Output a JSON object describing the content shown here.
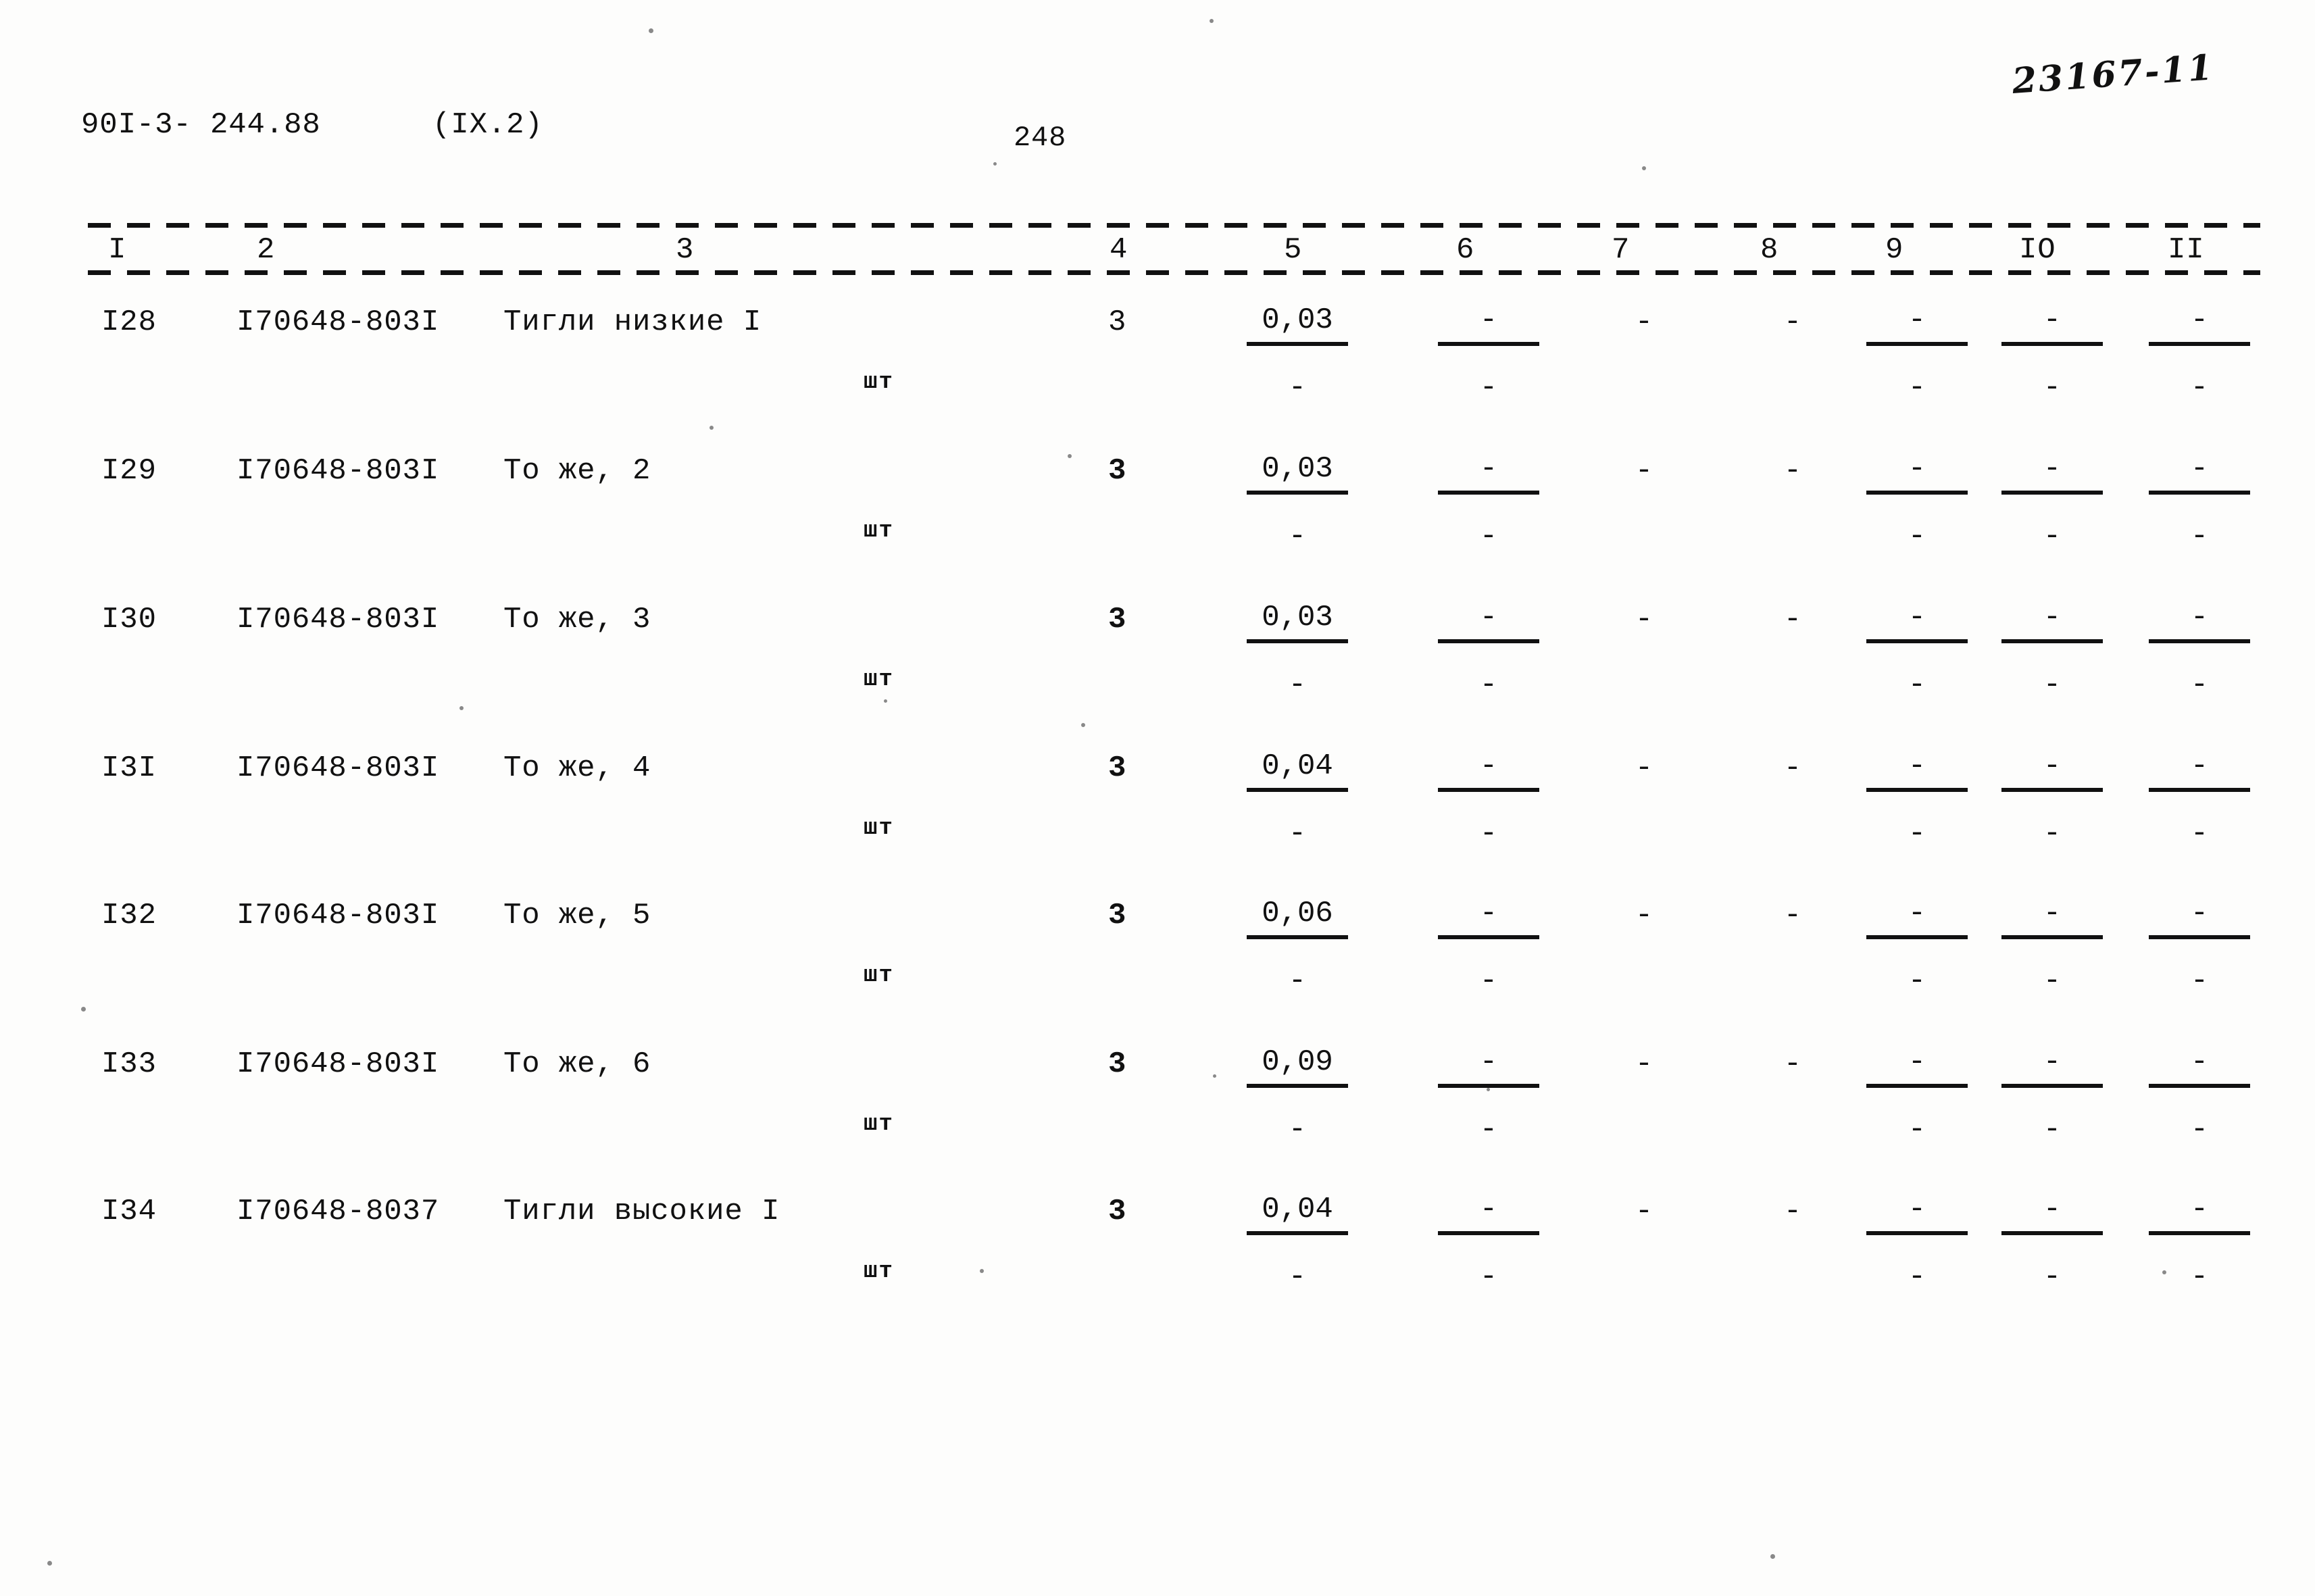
{
  "document": {
    "code": "90I-3- 244.88",
    "section": "(IX.2)",
    "page_number": "248",
    "archive_number": "23167-11"
  },
  "table": {
    "column_headers": [
      "I",
      "2",
      "3",
      "4",
      "5",
      "6",
      "7",
      "8",
      "9",
      "IO",
      "II"
    ],
    "unit_label": "шт",
    "dash": "-",
    "rows": [
      {
        "num": "I28",
        "code": "I70648-803I",
        "name": "Тигли низкие I",
        "unit": "шт",
        "c4": "3",
        "c5_num": "0,03",
        "c5_den": "-",
        "c6_num": "-",
        "c6_den": "-",
        "c7": "-",
        "c8": "-",
        "c9_num": "-",
        "c9_den": "-",
        "c10_num": "-",
        "c10_den": "-",
        "c11_num": "-",
        "c11_den": "-"
      },
      {
        "num": "I29",
        "code": "I70648-803I",
        "name": "То же, 2",
        "unit": "шт",
        "c4": "3",
        "c5_num": "0,03",
        "c5_den": "-",
        "c6_num": "-",
        "c6_den": "-",
        "c7": "-",
        "c8": "-",
        "c9_num": "-",
        "c9_den": "-",
        "c10_num": "-",
        "c10_den": "-",
        "c11_num": "-",
        "c11_den": "-"
      },
      {
        "num": "I30",
        "code": "I70648-803I",
        "name": "То же, 3",
        "unit": "шт",
        "c4": "3",
        "c5_num": "0,03",
        "c5_den": "-",
        "c6_num": "-",
        "c6_den": "-",
        "c7": "-",
        "c8": "-",
        "c9_num": "-",
        "c9_den": "-",
        "c10_num": "-",
        "c10_den": "-",
        "c11_num": "-",
        "c11_den": "-"
      },
      {
        "num": "I3I",
        "code": "I70648-803I",
        "name": "То же, 4",
        "unit": "шт",
        "c4": "3",
        "c5_num": "0,04",
        "c5_den": "-",
        "c6_num": "-",
        "c6_den": "-",
        "c7": "-",
        "c8": "-",
        "c9_num": "-",
        "c9_den": "-",
        "c10_num": "-",
        "c10_den": "-",
        "c11_num": "-",
        "c11_den": "-"
      },
      {
        "num": "I32",
        "code": "I70648-803I",
        "name": "То же, 5",
        "unit": "шт",
        "c4": "3",
        "c5_num": "0,06",
        "c5_den": "-",
        "c6_num": "-",
        "c6_den": "-",
        "c7": "-",
        "c8": "-",
        "c9_num": "-",
        "c9_den": "-",
        "c10_num": "-",
        "c10_den": "-",
        "c11_num": "-",
        "c11_den": "-"
      },
      {
        "num": "I33",
        "code": "I70648-803I",
        "name": "То же, 6",
        "unit": "шт",
        "c4": "3",
        "c5_num": "0,09",
        "c5_den": "-",
        "c6_num": "-",
        "c6_den": "-",
        "c7": "-",
        "c8": "-",
        "c9_num": "-",
        "c9_den": "-",
        "c10_num": "-",
        "c10_den": "-",
        "c11_num": "-",
        "c11_den": "-"
      },
      {
        "num": "I34",
        "code": "I70648-8037",
        "name": "Тигли высокие I",
        "unit": "шт",
        "c4": "3",
        "c5_num": "0,04",
        "c5_den": "-",
        "c6_num": "-",
        "c6_den": "-",
        "c7": "-",
        "c8": "-",
        "c9_num": "-",
        "c9_den": "-",
        "c10_num": "-",
        "c10_den": "-",
        "c11_num": "-",
        "c11_den": "-"
      }
    ]
  }
}
